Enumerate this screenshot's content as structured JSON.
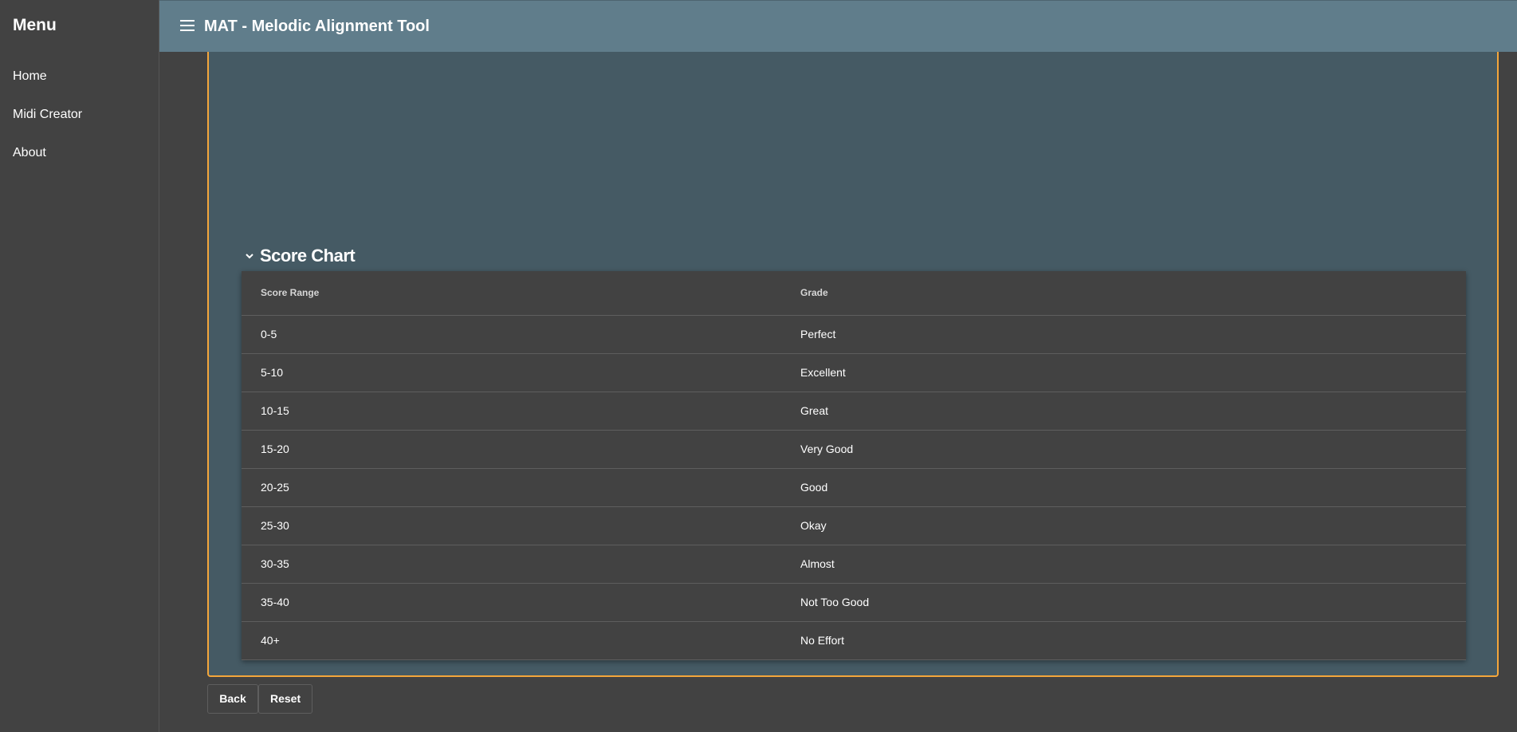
{
  "sidebar": {
    "title": "Menu",
    "items": [
      {
        "label": "Home"
      },
      {
        "label": "Midi Creator"
      },
      {
        "label": "About"
      }
    ]
  },
  "header": {
    "menu_icon": "hamburger-icon",
    "title": "MAT - Melodic Alignment Tool"
  },
  "score_chart": {
    "heading": "Score Chart",
    "expanded_icon": "chevron-down-icon",
    "columns": [
      "Score Range",
      "Grade"
    ],
    "rows": [
      {
        "range": "0-5",
        "grade": "Perfect"
      },
      {
        "range": "5-10",
        "grade": "Excellent"
      },
      {
        "range": "10-15",
        "grade": "Great"
      },
      {
        "range": "15-20",
        "grade": "Very Good"
      },
      {
        "range": "20-25",
        "grade": "Good"
      },
      {
        "range": "25-30",
        "grade": "Okay"
      },
      {
        "range": "30-35",
        "grade": "Almost"
      },
      {
        "range": "35-40",
        "grade": "Not Too Good"
      },
      {
        "range": "40+",
        "grade": "No Effort"
      }
    ]
  },
  "actions": {
    "back_label": "Back",
    "reset_label": "Reset"
  },
  "colors": {
    "sidebar_bg": "#424242",
    "header_bg": "#607d8b",
    "panel_bg": "#455a64",
    "panel_border": "#f4a63b",
    "table_bg": "#424242"
  }
}
